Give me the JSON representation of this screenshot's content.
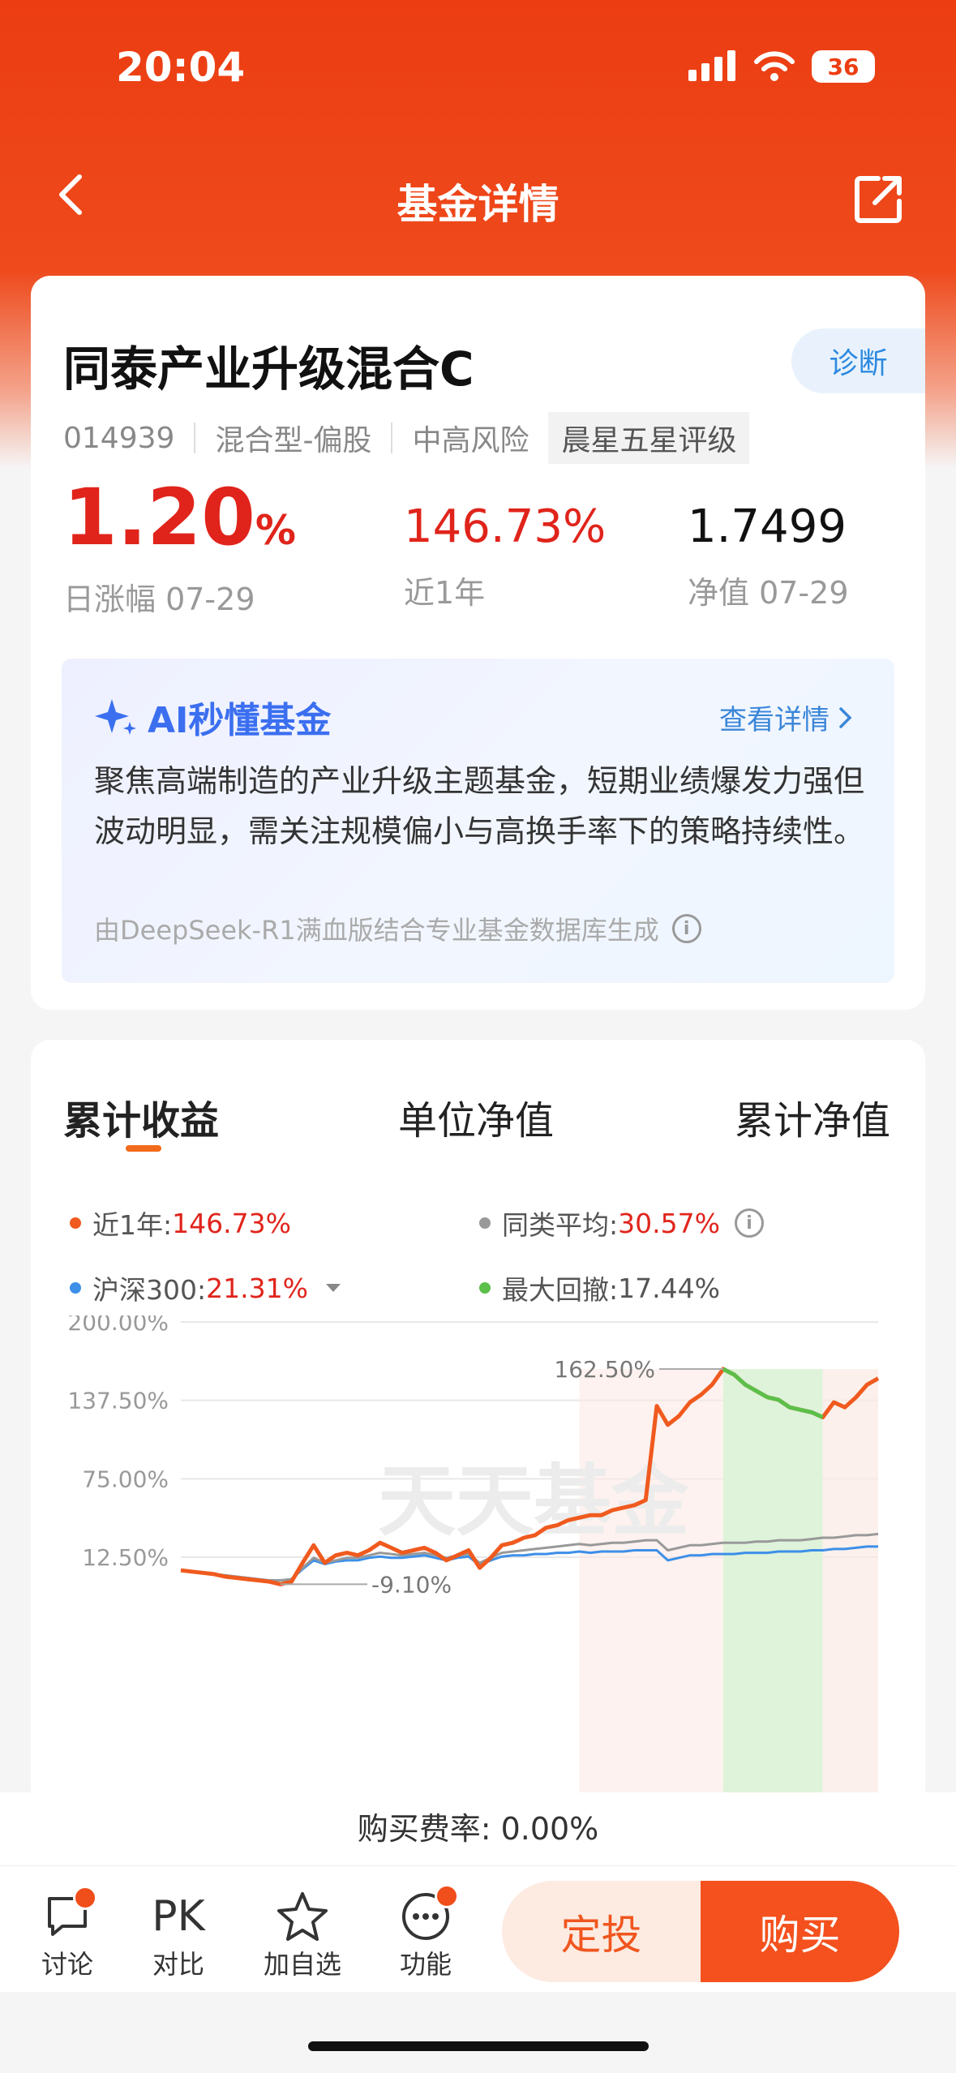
{
  "status": {
    "time": "20:04",
    "battery": "36"
  },
  "nav": {
    "title": "基金详情"
  },
  "fund": {
    "name": "同泰产业升级混合C",
    "diagnose": "诊断",
    "code": "014939",
    "type": "混合型-偏股",
    "risk": "中高风险",
    "rating": "晨星五星评级",
    "daily_change": "1.20",
    "daily_change_unit": "%",
    "daily_change_label": "日涨幅 07-29",
    "year_return": "146.73%",
    "year_return_label": "近1年",
    "nav_value": "1.7499",
    "nav_label": "净值 07-29"
  },
  "ai": {
    "title": "AI秒懂基金",
    "detail_link": "查看详情",
    "text": "聚焦高端制造的产业升级主题基金，短期业绩爆发力强但波动明显，需关注规模偏小与高换手率下的策略持续性。",
    "source": "由DeepSeek-R1满血版结合专业基金数据库生成"
  },
  "chart_tabs": [
    "累计收益",
    "单位净值",
    "累计净值"
  ],
  "legend": {
    "fund_label": "近1年:",
    "fund_value": "146.73%",
    "avg_label": "同类平均:",
    "avg_value": "30.57%",
    "hs300_label": "沪深300:",
    "hs300_value": "21.31%",
    "drawdown_label": "最大回撤:",
    "drawdown_value": "17.44%"
  },
  "colors": {
    "fund": "#f05a1e",
    "avg": "#999999",
    "hs300": "#3d8fe8",
    "drawdown": "#5cbf4a"
  },
  "chart_data": {
    "type": "line",
    "ylim": [
      -15,
      200
    ],
    "ytick_labels": [
      "200.00%",
      "137.50%",
      "75.00%",
      "12.50%"
    ],
    "yticks": [
      200,
      137.5,
      75,
      12.5
    ],
    "annotations": {
      "max": "162.50%",
      "min": "-9.10%"
    },
    "watermark": "天天基金",
    "series": [
      {
        "name": "近1年",
        "values": [
          2,
          1,
          0,
          -1,
          -3,
          -4,
          -5,
          -6,
          -7,
          -9.1,
          -7,
          8,
          22,
          8,
          14,
          16,
          14,
          18,
          24,
          20,
          16,
          18,
          20,
          16,
          10,
          14,
          18,
          4,
          12,
          22,
          24,
          28,
          30,
          36,
          38,
          42,
          44,
          46,
          46,
          50,
          52,
          54,
          58,
          133,
          118,
          125,
          136,
          142,
          150,
          162.5,
          158,
          150,
          145,
          140,
          138,
          132,
          130,
          128,
          124,
          136,
          132,
          140,
          150,
          155
        ]
      },
      {
        "name": "同类平均",
        "values": [
          2,
          1,
          0,
          -1,
          -2,
          -3,
          -4,
          -5,
          -6,
          -6,
          -5,
          4,
          12,
          8,
          10,
          12,
          12,
          14,
          16,
          15,
          14,
          15,
          16,
          14,
          12,
          14,
          15,
          8,
          12,
          16,
          17,
          18,
          19,
          20,
          21,
          22,
          23,
          22,
          23,
          24,
          24,
          25,
          26,
          26,
          18,
          20,
          22,
          22,
          23,
          24,
          24,
          24,
          25,
          25,
          26,
          26,
          26,
          27,
          28,
          28,
          29,
          30,
          30,
          31
        ]
      },
      {
        "name": "沪深300",
        "values": [
          2,
          1,
          0,
          -1,
          -2,
          -3,
          -4,
          -5,
          -6,
          -6,
          -5,
          3,
          10,
          7,
          9,
          10,
          10,
          12,
          13,
          12,
          12,
          13,
          14,
          12,
          10,
          12,
          13,
          6,
          10,
          13,
          14,
          14,
          15,
          15,
          16,
          16,
          17,
          16,
          17,
          17,
          17,
          18,
          18,
          18,
          10,
          12,
          14,
          14,
          15,
          15,
          15,
          16,
          16,
          16,
          17,
          17,
          17,
          18,
          18,
          19,
          19,
          20,
          21,
          21
        ]
      }
    ],
    "drawdown_start_index": 49,
    "drawdown_end_index": 58
  },
  "fee": "购买费率: 0.00%",
  "bottom": {
    "discuss": "讨论",
    "pk_icon": "PK",
    "compare": "对比",
    "watch": "加自选",
    "function": "功能",
    "dingtou": "定投",
    "buy": "购买"
  }
}
